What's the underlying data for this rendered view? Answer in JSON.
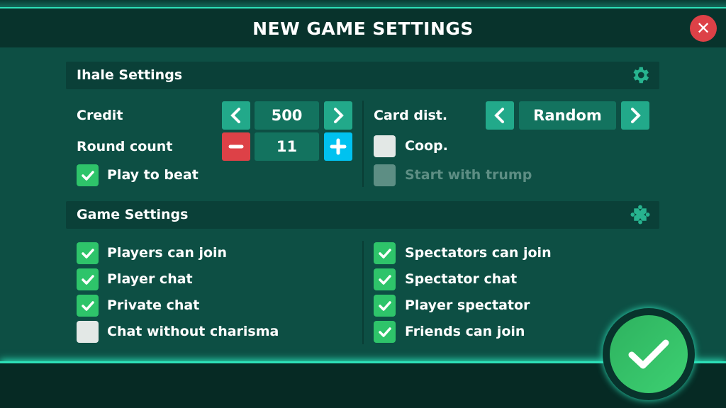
{
  "title": "NEW GAME SETTINGS",
  "icons": {
    "close": "close-icon",
    "ihale": "gear-icon",
    "game": "puzzle-icon",
    "confirm": "checkmark-icon"
  },
  "colors": {
    "background": "#0d4f44",
    "header": "#08332c",
    "accent": "#22a98a",
    "check": "#2ec46a",
    "minus": "#dd4147",
    "plus": "#00c2f0",
    "glow": "#2de0b8"
  },
  "ihale": {
    "label": "Ihale Settings",
    "credit": {
      "label": "Credit",
      "value": "500"
    },
    "round_count": {
      "label": "Round count",
      "value": "11"
    },
    "play_to_beat": {
      "label": "Play to beat",
      "checked": true
    },
    "card_dist": {
      "label": "Card dist.",
      "value": "Random"
    },
    "coop": {
      "label": "Coop.",
      "checked": false
    },
    "start_with_trump": {
      "label": "Start with trump",
      "checked": false,
      "disabled": true
    }
  },
  "game": {
    "label": "Game Settings",
    "left": [
      {
        "label": "Players can join",
        "checked": true
      },
      {
        "label": "Player chat",
        "checked": true
      },
      {
        "label": "Private chat",
        "checked": true
      },
      {
        "label": "Chat without charisma",
        "checked": false
      }
    ],
    "right": [
      {
        "label": "Spectators can join",
        "checked": true
      },
      {
        "label": "Spectator chat",
        "checked": true
      },
      {
        "label": "Player spectator",
        "checked": true
      },
      {
        "label": "Friends can join",
        "checked": true
      }
    ]
  }
}
